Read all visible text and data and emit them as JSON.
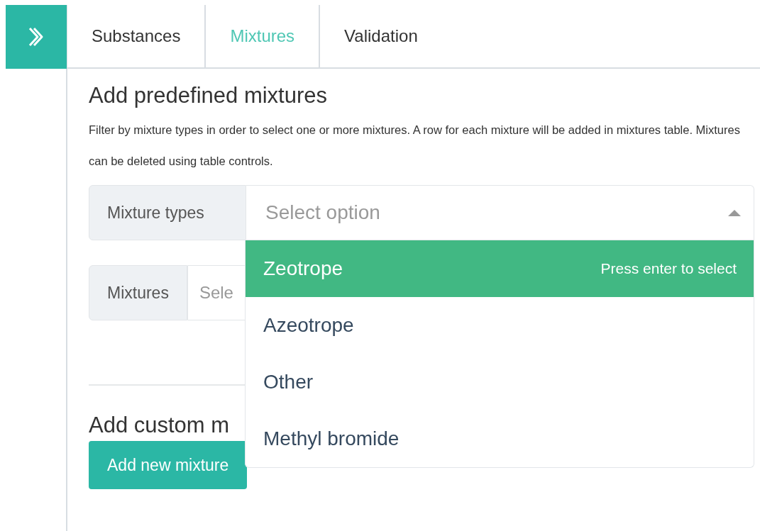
{
  "tabs": [
    {
      "label": "Substances",
      "selected": false
    },
    {
      "label": "Mixtures",
      "selected": true
    },
    {
      "label": "Validation",
      "selected": false
    }
  ],
  "predefined": {
    "title": "Add predefined mixtures",
    "description": "Filter by mixture types in order to select one or more mixtures. A row for each mixture will be added in mixtures table. Mixtures can be deleted using table controls.",
    "mixture_types": {
      "label": "Mixture types",
      "placeholder": "Select option",
      "expanded": true,
      "options": [
        {
          "label": "Zeotrope",
          "selected": true,
          "hint": "Press enter to select"
        },
        {
          "label": "Azeotrope",
          "selected": false
        },
        {
          "label": "Other",
          "selected": false
        },
        {
          "label": "Methyl bromide",
          "selected": false
        }
      ]
    },
    "mixtures": {
      "label": "Mixtures",
      "placeholder": "Sele"
    }
  },
  "custom": {
    "title": "Add custom m",
    "button": "Add new mixture"
  }
}
